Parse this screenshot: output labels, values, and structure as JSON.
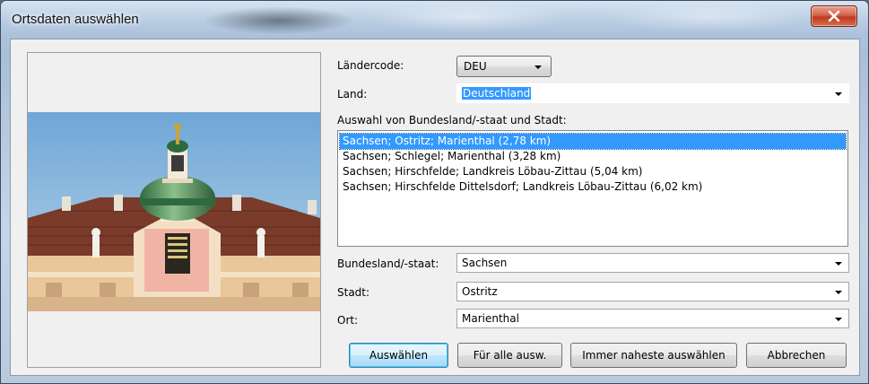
{
  "window": {
    "title": "Ortsdaten auswählen"
  },
  "fields": {
    "laendercode": {
      "label": "Ländercode:",
      "value": "DEU"
    },
    "land": {
      "label": "Land:",
      "value": "Deutschland"
    },
    "bundesland": {
      "label": "Bundesland/-staat:",
      "value": "Sachsen"
    },
    "stadt": {
      "label": "Stadt:",
      "value": "Ostritz"
    },
    "ort": {
      "label": "Ort:",
      "value": "Marienthal"
    }
  },
  "selection": {
    "heading": "Auswahl von Bundesland/-staat und Stadt:",
    "items": [
      {
        "text": "Sachsen; Ostritz; Marienthal (2,78 km)",
        "selected": true
      },
      {
        "text": "Sachsen; Schlegel; Marienthal (3,28 km)",
        "selected": false
      },
      {
        "text": "Sachsen; Hirschfelde; Landkreis Löbau-Zittau (5,04 km)",
        "selected": false
      },
      {
        "text": "Sachsen; Hirschfelde Dittelsdorf; Landkreis Löbau-Zittau (6,02 km)",
        "selected": false
      }
    ]
  },
  "buttons": {
    "auswaehlen": "Auswählen",
    "fuer_alle": "Für alle ausw.",
    "immer_naheste": "Immer naheste auswählen",
    "abbrechen": "Abbrechen"
  },
  "colors": {
    "selection": "#3399ff",
    "close_button": "#c7452a"
  },
  "icons": {
    "close": "close-icon",
    "dropdown": "chevron-down-icon"
  }
}
